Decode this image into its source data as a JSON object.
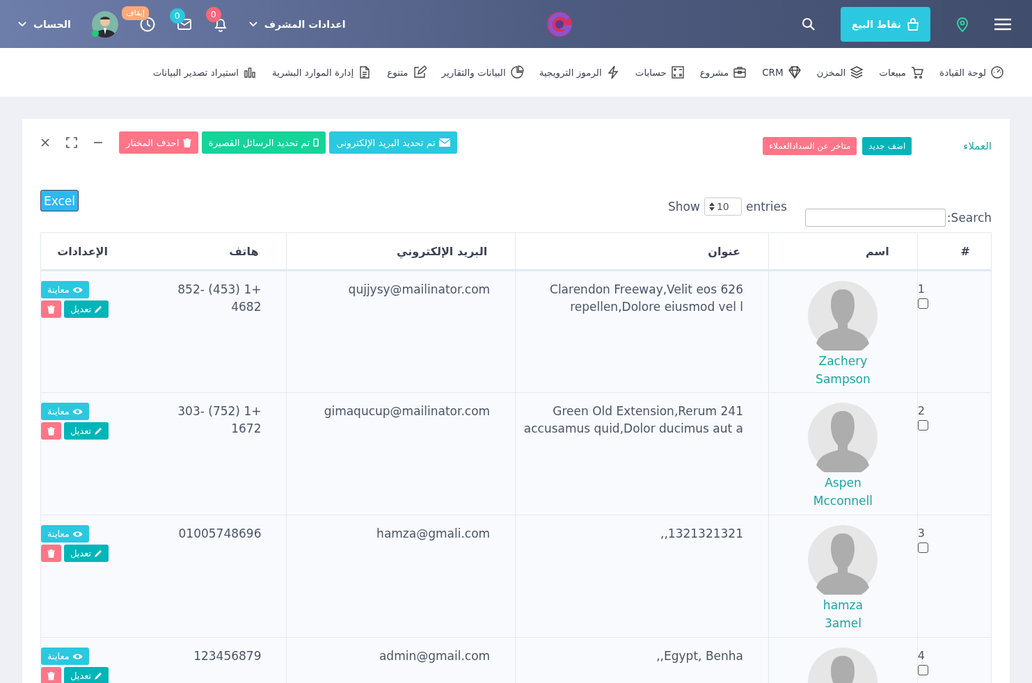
{
  "header": {
    "pos_button": "نقاط البيع",
    "admin_settings": "اعدادات المشرف",
    "notifications_count": "0",
    "messages_count": "0",
    "timer_badge": "إيقاف",
    "account": "الحساب",
    "online": true
  },
  "nav": [
    {
      "label": "لوحة القيادة",
      "kind": "gauge"
    },
    {
      "label": "مبيعات",
      "kind": "cart"
    },
    {
      "label": "المخزن",
      "kind": "layers"
    },
    {
      "label": "CRM",
      "kind": "diamond"
    },
    {
      "label": "مشروع",
      "kind": "briefcase"
    },
    {
      "label": "حسابات",
      "kind": "calculator"
    },
    {
      "label": "الرموز الترويجية",
      "kind": "bolt"
    },
    {
      "label": "البيانات والتقارير",
      "kind": "pie"
    },
    {
      "label": "متنوع",
      "kind": "edit"
    },
    {
      "label": "إدارة الموارد البشرية",
      "kind": "file"
    },
    {
      "label": "استيراد تصدير البيانات",
      "kind": "bars"
    }
  ],
  "panel": {
    "title": "العملاء",
    "buttons": [
      {
        "label": "اضف جديد",
        "kind": "teal"
      },
      {
        "label": "متاخر عن السدادالعملاء",
        "kind": "red"
      }
    ],
    "actions": [
      {
        "label": "تم تحديد البريد الإلكتروني",
        "kind": "email"
      },
      {
        "label": "تم تحديد الرسائل القصيرة",
        "kind": "sms"
      },
      {
        "label": "احذف المختار",
        "kind": "delete"
      }
    ],
    "excel": "Excel",
    "show": "Show",
    "length": "10",
    "entries": "entries",
    "search_label": "Search:"
  },
  "table": {
    "columns": [
      "#",
      "اسم",
      "عنوان",
      "البريد الإلكتروني",
      "هاتف",
      "الإعدادات"
    ],
    "rows": [
      {
        "number": "1",
        "checked": false,
        "name": "Zachery Sampson",
        "address": "Clarendon Freeway,Velit eos 626 repellen,Dolore eiusmod vel l",
        "email": "qujjysy@mailinator.com",
        "phone": "+1 (453) 852-4682",
        "view": "معاينة",
        "edit": "تعديل"
      },
      {
        "number": "2",
        "checked": false,
        "name": "Aspen Mcconnell",
        "address": "Green Old Extension,Rerum 241 accusamus quid,Dolor ducimus aut a",
        "email": "gimaqucup@mailinator.com",
        "phone": "+1 (752) 303-1672",
        "view": "معاينة",
        "edit": "تعديل"
      },
      {
        "number": "3",
        "checked": false,
        "name": "hamza 3amel",
        "address": "1321321321,,",
        "email": "hamza@gmali.com",
        "phone": "01005748696",
        "view": "معاينة",
        "edit": "تعديل"
      },
      {
        "number": "4",
        "checked": false,
        "address": "Egypt, Benha,,",
        "email": "admin@gmail.com",
        "phone": "123456879",
        "view": "معاينة",
        "edit": "تعديل"
      }
    ]
  }
}
